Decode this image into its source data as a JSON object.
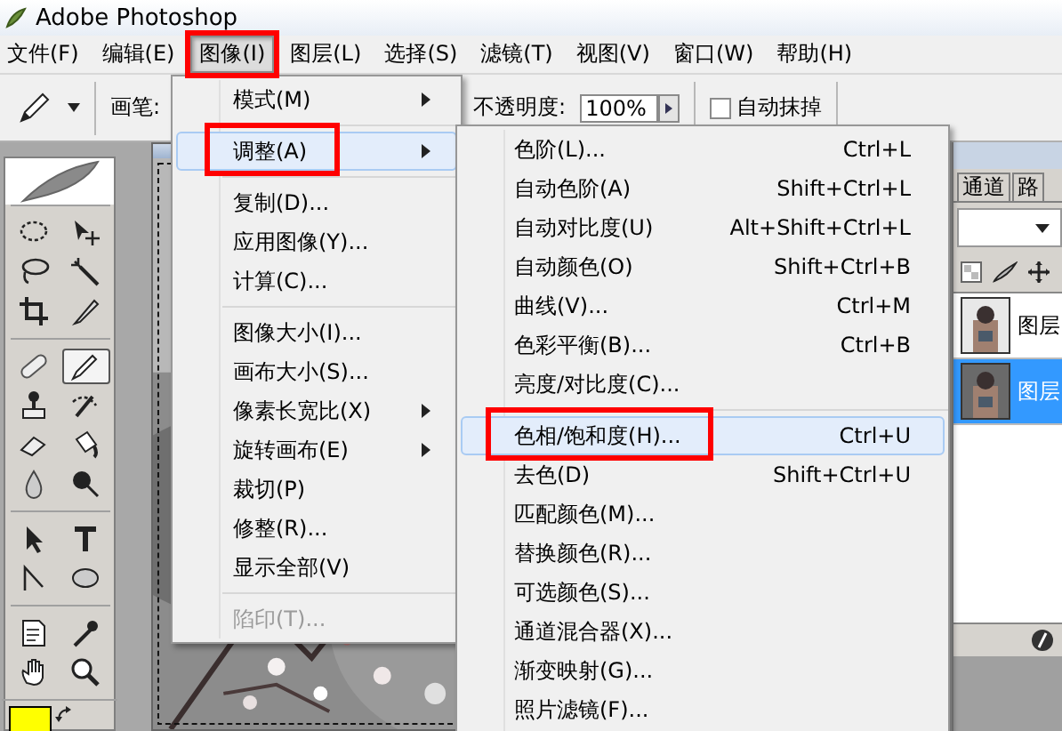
{
  "window": {
    "title": "Adobe Photoshop"
  },
  "menubar": [
    {
      "label": "文件(F)",
      "selected": false,
      "marked": false
    },
    {
      "label": "编辑(E)",
      "selected": false,
      "marked": false
    },
    {
      "label": "图像(I)",
      "selected": true,
      "marked": true
    },
    {
      "label": "图层(L)",
      "selected": false,
      "marked": false
    },
    {
      "label": "选择(S)",
      "selected": false,
      "marked": false
    },
    {
      "label": "滤镜(T)",
      "selected": false,
      "marked": false
    },
    {
      "label": "视图(V)",
      "selected": false,
      "marked": false
    },
    {
      "label": "窗口(W)",
      "selected": false,
      "marked": false
    },
    {
      "label": "帮助(H)",
      "selected": false,
      "marked": false
    }
  ],
  "options_bar": {
    "brush_label": "画笔:",
    "opacity_label": "不透明度:",
    "opacity_value": "100%",
    "auto_erase": {
      "label": "自动抹掉",
      "checked": false
    }
  },
  "toolbox": {
    "groups": [
      {
        "tools": [
          {
            "kind": "marquee",
            "selected": false
          },
          {
            "kind": "move",
            "selected": false
          },
          {
            "kind": "lasso",
            "selected": false
          },
          {
            "kind": "wand",
            "selected": false
          },
          {
            "kind": "crop",
            "selected": false
          },
          {
            "kind": "slice",
            "selected": false
          }
        ]
      },
      {
        "tools": [
          {
            "kind": "healing",
            "selected": false
          },
          {
            "kind": "pencil",
            "selected": true
          },
          {
            "kind": "stamp",
            "selected": false
          },
          {
            "kind": "history",
            "selected": false
          },
          {
            "kind": "eraser",
            "selected": false
          },
          {
            "kind": "bucket",
            "selected": false
          },
          {
            "kind": "blur",
            "selected": false
          },
          {
            "kind": "dodge",
            "selected": false
          }
        ]
      },
      {
        "tools": [
          {
            "kind": "select",
            "selected": false
          },
          {
            "kind": "type",
            "selected": false
          },
          {
            "kind": "path",
            "selected": false
          },
          {
            "kind": "shape",
            "selected": false
          }
        ]
      },
      {
        "tools": [
          {
            "kind": "notes",
            "selected": false
          },
          {
            "kind": "eyedropper",
            "selected": false
          },
          {
            "kind": "hand",
            "selected": false
          },
          {
            "kind": "zoom",
            "selected": false
          }
        ]
      }
    ]
  },
  "image_menu": {
    "items": [
      {
        "kind": "item",
        "label": "模式(M)",
        "submenu": true,
        "selected": false,
        "disabled": false,
        "marked": false
      },
      {
        "kind": "separator"
      },
      {
        "kind": "item",
        "label": "调整(A)",
        "submenu": true,
        "selected": true,
        "disabled": false,
        "marked": true
      },
      {
        "kind": "separator"
      },
      {
        "kind": "item",
        "label": "复制(D)...",
        "submenu": false,
        "selected": false,
        "disabled": false,
        "marked": false
      },
      {
        "kind": "item",
        "label": "应用图像(Y)...",
        "submenu": false,
        "selected": false,
        "disabled": false,
        "marked": false
      },
      {
        "kind": "item",
        "label": "计算(C)...",
        "submenu": false,
        "selected": false,
        "disabled": false,
        "marked": false
      },
      {
        "kind": "separator"
      },
      {
        "kind": "item",
        "label": "图像大小(I)...",
        "submenu": false,
        "selected": false,
        "disabled": false,
        "marked": false
      },
      {
        "kind": "item",
        "label": "画布大小(S)...",
        "submenu": false,
        "selected": false,
        "disabled": false,
        "marked": false
      },
      {
        "kind": "item",
        "label": "像素长宽比(X)",
        "submenu": true,
        "selected": false,
        "disabled": false,
        "marked": false
      },
      {
        "kind": "item",
        "label": "旋转画布(E)",
        "submenu": true,
        "selected": false,
        "disabled": false,
        "marked": false
      },
      {
        "kind": "item",
        "label": "裁切(P)",
        "submenu": false,
        "selected": false,
        "disabled": false,
        "marked": false
      },
      {
        "kind": "item",
        "label": "修整(R)...",
        "submenu": false,
        "selected": false,
        "disabled": false,
        "marked": false
      },
      {
        "kind": "item",
        "label": "显示全部(V)",
        "submenu": false,
        "selected": false,
        "disabled": false,
        "marked": false
      },
      {
        "kind": "separator"
      },
      {
        "kind": "item",
        "label": "陷印(T)...",
        "submenu": false,
        "selected": false,
        "disabled": true,
        "marked": false
      }
    ]
  },
  "adjust_menu": {
    "items": [
      {
        "kind": "item",
        "label": "色阶(L)...",
        "shortcut": "Ctrl+L",
        "selected": false,
        "marked": false
      },
      {
        "kind": "item",
        "label": "自动色阶(A)",
        "shortcut": "Shift+Ctrl+L",
        "selected": false,
        "marked": false
      },
      {
        "kind": "item",
        "label": "自动对比度(U)",
        "shortcut": "Alt+Shift+Ctrl+L",
        "selected": false,
        "marked": false
      },
      {
        "kind": "item",
        "label": "自动颜色(O)",
        "shortcut": "Shift+Ctrl+B",
        "selected": false,
        "marked": false
      },
      {
        "kind": "item",
        "label": "曲线(V)...",
        "shortcut": "Ctrl+M",
        "selected": false,
        "marked": false
      },
      {
        "kind": "item",
        "label": "色彩平衡(B)...",
        "shortcut": "Ctrl+B",
        "selected": false,
        "marked": false
      },
      {
        "kind": "item",
        "label": "亮度/对比度(C)...",
        "selected": false,
        "marked": false
      },
      {
        "kind": "separator"
      },
      {
        "kind": "item",
        "label": "色相/饱和度(H)...",
        "shortcut": "Ctrl+U",
        "selected": true,
        "marked": true
      },
      {
        "kind": "item",
        "label": "去色(D)",
        "shortcut": "Shift+Ctrl+U",
        "selected": false,
        "marked": false
      },
      {
        "kind": "item",
        "label": "匹配颜色(M)...",
        "selected": false,
        "marked": false
      },
      {
        "kind": "item",
        "label": "替换颜色(R)...",
        "selected": false,
        "marked": false
      },
      {
        "kind": "item",
        "label": "可选颜色(S)...",
        "selected": false,
        "marked": false
      },
      {
        "kind": "item",
        "label": "通道混合器(X)...",
        "selected": false,
        "marked": false
      },
      {
        "kind": "item",
        "label": "渐变映射(G)...",
        "selected": false,
        "marked": false
      },
      {
        "kind": "item",
        "label": "照片滤镜(F)...",
        "selected": false,
        "marked": false
      }
    ]
  },
  "layers_panel": {
    "tabs": [
      {
        "label": "通道",
        "selected": false
      },
      {
        "label": "路",
        "selected": false
      }
    ],
    "layers": [
      {
        "name": "图层",
        "selected": false
      },
      {
        "name": "图层",
        "selected": true
      }
    ]
  }
}
